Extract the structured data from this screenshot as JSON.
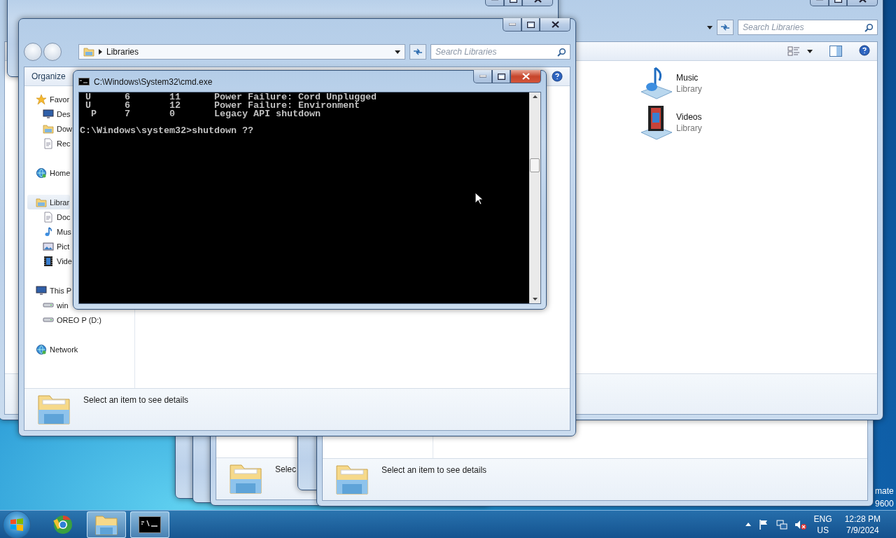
{
  "back_window": {
    "search_placeholder": "Search Libraries",
    "libraries": [
      {
        "name": "Music",
        "subtitle": "Library",
        "kind": "music"
      },
      {
        "name": "Videos",
        "subtitle": "Library",
        "kind": "videos"
      }
    ]
  },
  "stacked_windows": [
    {
      "details": "Selec"
    },
    {
      "details": "Select an item to see details"
    }
  ],
  "explorer": {
    "address": "Libraries",
    "search_placeholder": "Search Libraries",
    "toolbar": "Organize",
    "nav": [
      {
        "label": "Favor",
        "kind": "star",
        "selected": false,
        "children": [
          {
            "label": "Des",
            "kind": "desktop",
            "selected": false
          },
          {
            "label": "Dow",
            "kind": "downloads",
            "selected": false
          },
          {
            "label": "Rec",
            "kind": "recent",
            "selected": false
          }
        ]
      },
      {
        "label": "Home",
        "kind": "homegroup",
        "selected": false
      },
      {
        "label": "Librar",
        "kind": "libraries",
        "selected": true,
        "children": [
          {
            "label": "Doc",
            "kind": "documents",
            "selected": false
          },
          {
            "label": "Mus",
            "kind": "music",
            "selected": false
          },
          {
            "label": "Pict",
            "kind": "pictures",
            "selected": false
          },
          {
            "label": "Vide",
            "kind": "videos",
            "selected": false
          }
        ]
      },
      {
        "label": "This P",
        "kind": "computer",
        "selected": false,
        "children": [
          {
            "label": "win",
            "kind": "drive",
            "selected": false
          },
          {
            "label": "OREO P (D:)",
            "kind": "removable",
            "selected": false
          }
        ]
      },
      {
        "label": "Network",
        "kind": "network",
        "selected": false
      }
    ],
    "details": "Select an item to see details"
  },
  "console": {
    "title": "C:\\Windows\\System32\\cmd.exe",
    "lines": [
      " U      6       11      Power Failure: Cord Unplugged",
      " U      6       12      Power Failure: Environment",
      "  P     7       0       Legacy API shutdown"
    ],
    "prompt": "C:\\Windows\\system32>shutdown ??"
  },
  "desktop_text": [
    "mate",
    "9600"
  ],
  "taskbar": {
    "apps": [
      {
        "kind": "browser",
        "running": false
      },
      {
        "kind": "explorer",
        "running": true
      },
      {
        "kind": "console",
        "running": true
      }
    ],
    "tray": {
      "language": "ENG",
      "region": "US",
      "time": "12:28 PM",
      "date": "7/9/2024"
    }
  }
}
